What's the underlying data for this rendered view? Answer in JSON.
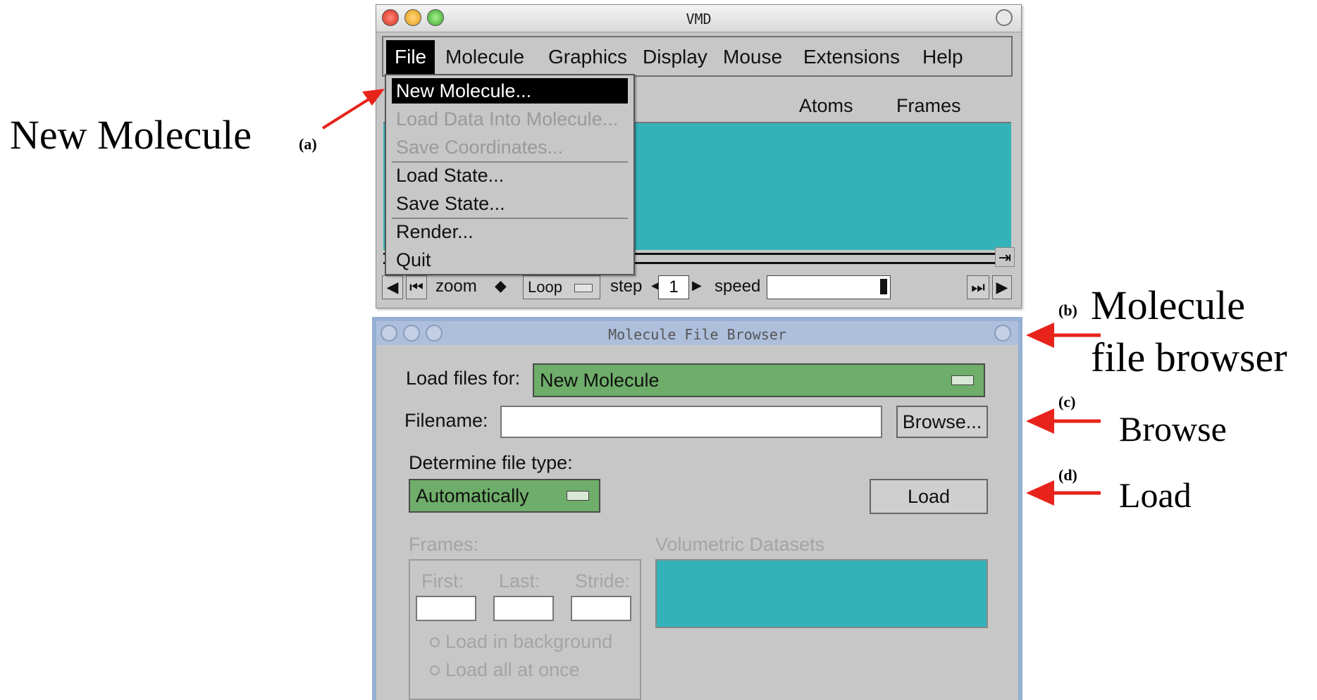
{
  "vmd": {
    "title": "VMD",
    "menus": [
      "File",
      "Molecule",
      "Graphics",
      "Display",
      "Mouse",
      "Extensions",
      "Help"
    ],
    "columns": [
      "Atoms",
      "Frames"
    ],
    "file_menu": [
      {
        "label": "New Molecule...",
        "state": "highlighted"
      },
      {
        "label": "Load Data Into Molecule...",
        "state": "disabled"
      },
      {
        "label": "Save Coordinates...",
        "state": "disabled"
      },
      {
        "label": "Load State...",
        "state": "normal"
      },
      {
        "label": "Save State...",
        "state": "normal"
      },
      {
        "label": "Render...",
        "state": "normal"
      },
      {
        "label": "Quit",
        "state": "normal"
      }
    ],
    "animation": {
      "zoom_label": "zoom",
      "loop_label": "Loop",
      "step_label": "step",
      "step_value": "1",
      "speed_label": "speed"
    }
  },
  "browser": {
    "title": "Molecule File Browser",
    "load_files_for_label": "Load files for:",
    "load_files_for_value": "New Molecule",
    "filename_label": "Filename:",
    "filename_value": "",
    "browse_label": "Browse...",
    "file_type_label": "Determine file type:",
    "file_type_value": "Automatically",
    "load_label": "Load",
    "frames_label": "Frames:",
    "first_label": "First:",
    "last_label": "Last:",
    "stride_label": "Stride:",
    "load_background_label": "Load in background",
    "load_all_label": "Load all at once",
    "volumetric_label": "Volumetric Datasets"
  },
  "annotations": {
    "a_text": "New Molecule",
    "a_tag": "(a)",
    "b_tag": "(b)",
    "b_text_1": "Molecule",
    "b_text_2": "file browser",
    "c_tag": "(c)",
    "c_text": "Browse",
    "d_tag": "(d)",
    "d_text": "Load"
  },
  "colors": {
    "teal": "#33b3b9",
    "green": "#6fae6a",
    "arrow_red": "#e8231c"
  }
}
